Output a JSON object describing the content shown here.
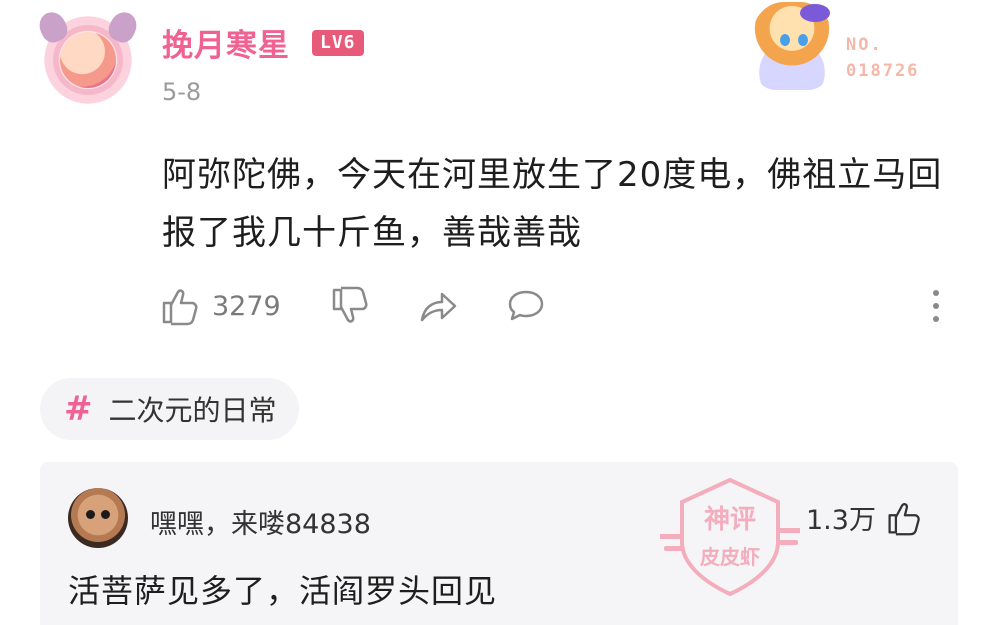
{
  "post": {
    "author": {
      "name": "挽月寒星",
      "level": "LV6"
    },
    "date": "5-8",
    "badge": {
      "label": "NO.",
      "number": "018726"
    },
    "content": "阿弥陀佛，今天在河里放生了20度电，佛祖立马回报了我几十斤鱼，善哉善哉",
    "actions": {
      "like_count": "3279",
      "icons": [
        "thumbs-up-icon",
        "thumbs-down-icon",
        "share-icon",
        "comment-icon",
        "more-icon"
      ]
    }
  },
  "tag": {
    "symbol": "#",
    "label": "二次元的日常"
  },
  "top_comment": {
    "author": "嘿嘿，来喽84838",
    "text": "活菩萨见多了，活阎罗头回见",
    "like_count": "1.3万",
    "stamp": {
      "line1": "神评",
      "line2": "皮皮虾"
    }
  },
  "colors": {
    "accent_pink": "#f06292",
    "level_badge": "#e85a7a",
    "muted_text": "#9a9a9a",
    "stamp": "#f3a1b2"
  }
}
